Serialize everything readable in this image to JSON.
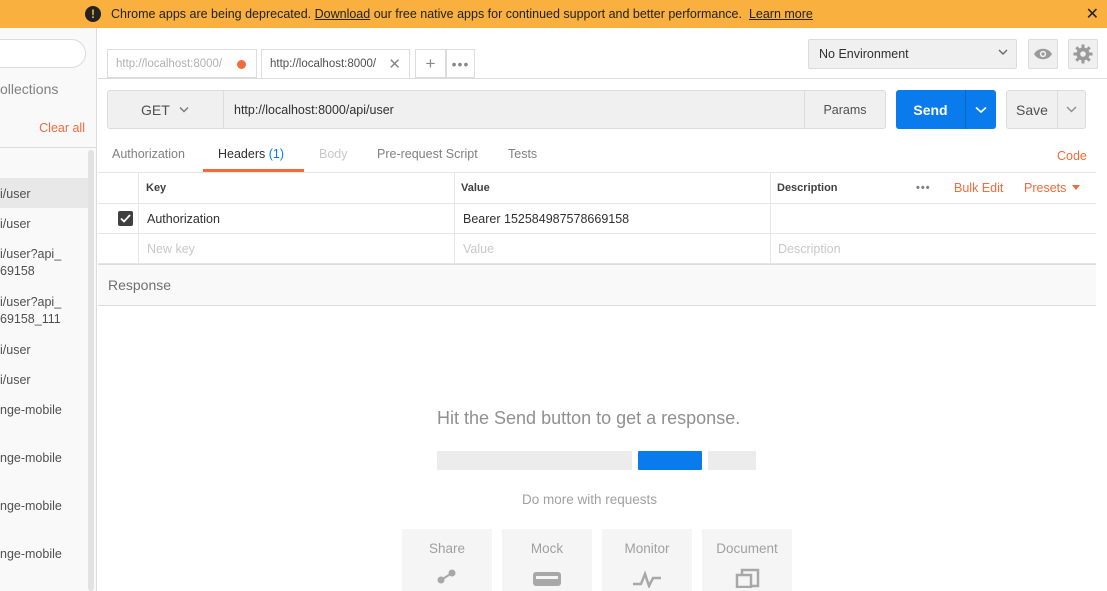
{
  "banner": {
    "text_before": "Chrome apps are being deprecated.",
    "download_link": "Download",
    "text_after": "our free native apps for continued support and better performance.",
    "learn_more_link": "Learn more",
    "close_glyph": "✕"
  },
  "sidebar": {
    "collections_label": "ollections",
    "clear_all": "Clear all",
    "history": [
      "i/user",
      "i/user",
      "i/user?api_ 69158",
      "i/user?api_ 69158_111",
      "i/user",
      "i/user",
      "nge-mobile",
      "nge-mobile",
      "nge-mobile",
      "nge-mobile"
    ]
  },
  "tabs": {
    "tab1_label": "http://localhost:8000/",
    "tab2_label": "http://localhost:8000/",
    "plus_glyph": "+",
    "more_glyph": "•••",
    "close_glyph": "✕"
  },
  "environment": {
    "selected": "No Environment"
  },
  "request": {
    "method": "GET",
    "url": "http://localhost:8000/api/user",
    "params_label": "Params",
    "send_label": "Send",
    "save_label": "Save"
  },
  "request_tabs": {
    "authorization": "Authorization",
    "headers": "Headers",
    "headers_count": "(1)",
    "body": "Body",
    "pre_request": "Pre-request Script",
    "tests": "Tests",
    "code": "Code"
  },
  "headers_table": {
    "col_key": "Key",
    "col_value": "Value",
    "col_description": "Description",
    "more_glyph": "•••",
    "bulk_edit": "Bulk Edit",
    "presets": "Presets",
    "rows": [
      {
        "key": "Authorization",
        "value": "Bearer 152584987578669158",
        "description": ""
      }
    ],
    "new_key_placeholder": "New key",
    "new_value_placeholder": "Value",
    "new_description_placeholder": "Description"
  },
  "response": {
    "label": "Response",
    "hint": "Hit the Send button to get a response.",
    "do_more": "Do more with requests",
    "cards": [
      "Share",
      "Mock",
      "Monitor",
      "Document"
    ]
  },
  "colors": {
    "accent_orange": "#f26b3a",
    "send_blue": "#097bed",
    "banner_yellow": "#f9b03f"
  }
}
